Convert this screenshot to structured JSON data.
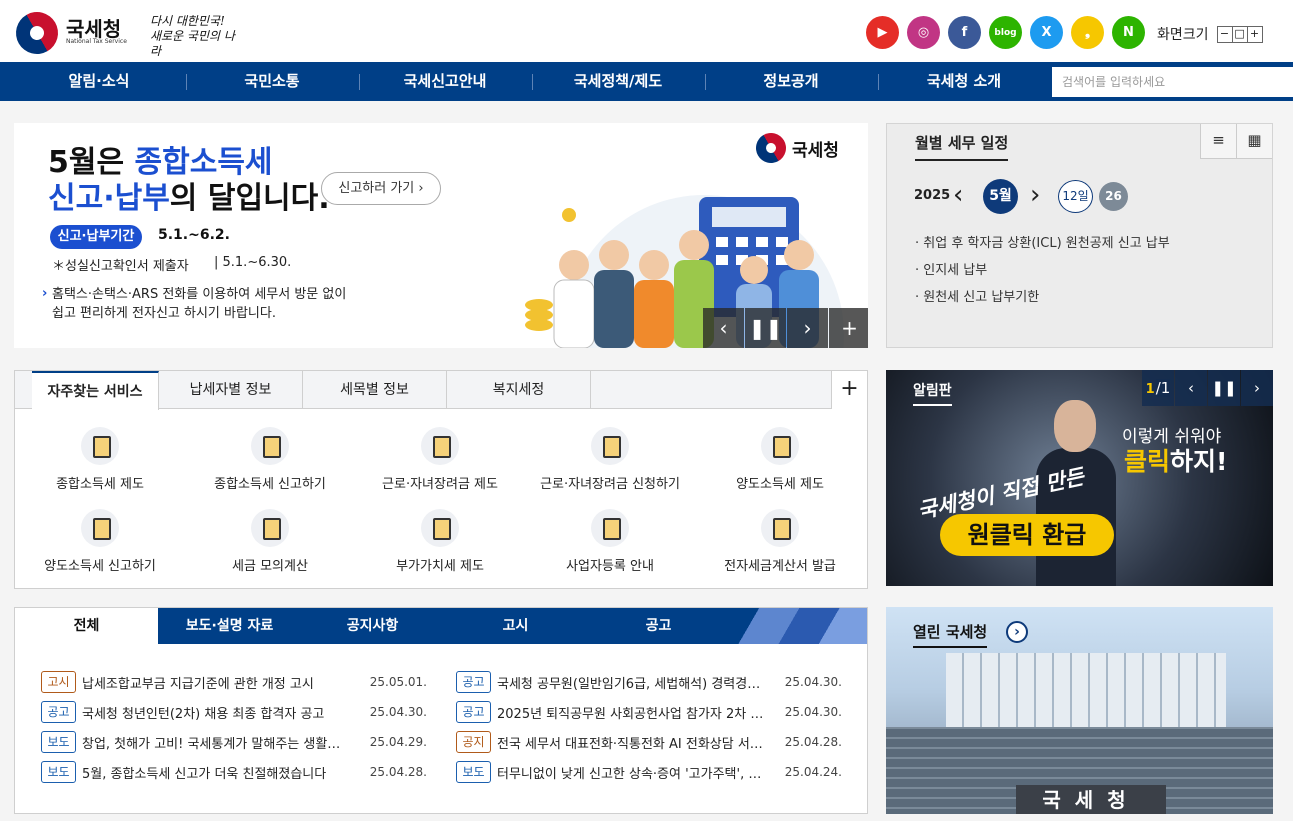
{
  "header": {
    "logo_title": "국세청",
    "logo_sub": "National Tax Service",
    "slogan": "다시 대한민국! 새로운 국민의 나라",
    "sns": [
      {
        "icon": "youtube-icon",
        "glyph": "▶",
        "color": "#e52d27"
      },
      {
        "icon": "instagram-icon",
        "glyph": "◎",
        "color": "#c13584"
      },
      {
        "icon": "facebook-icon",
        "glyph": "f",
        "color": "#3b5998"
      },
      {
        "icon": "blog-icon",
        "glyph": "blog",
        "color": "#2db400"
      },
      {
        "icon": "x-icon",
        "glyph": "X",
        "color": "#1d9bf0"
      },
      {
        "icon": "kakao-story-icon",
        "glyph": "❟",
        "color": "#f6c700"
      },
      {
        "icon": "naver-post-icon",
        "glyph": "N",
        "color": "#2db400"
      }
    ],
    "fontsize_label": "화면크기",
    "fontsize_buttons": [
      "−",
      "□",
      "+"
    ]
  },
  "gnb": {
    "items": [
      "알림·소식",
      "국민소통",
      "국세신고안내",
      "국세정책/제도",
      "정보공개",
      "국세청 소개"
    ],
    "search_placeholder": "검색어를 입력하세요"
  },
  "banner": {
    "line1_pre": "5월은 ",
    "line1_hl": "종합소득세",
    "line2_hl": "신고·납부",
    "line2_post": "의 달입니다.",
    "cta": "신고하러 가기 ›",
    "period_tag": "신고·납부기간",
    "period": "5.1.~6.2.",
    "sub_label": "＊성실신고확인서 제출자",
    "sub_period": "|   5.1.~6.30.",
    "desc1": "홈택스·손택스·ARS 전화를 이용하여 세무서 방문 없이",
    "desc2": "쉽고 편리하게 전자신고 하시기 바랍니다.",
    "brand": "국세청",
    "controls": [
      "‹",
      "❚❚",
      "›",
      "+"
    ]
  },
  "calendar": {
    "title": "월별 세무 일정",
    "icons": [
      "≡",
      "▦"
    ],
    "year": "2025",
    "prev": "‹",
    "month": "5월",
    "next": "›",
    "day_a": "12일",
    "day_b": "26",
    "items": [
      "취업 후 학자금 상환(ICL) 원천공제 신고 납부",
      "인지세 납부",
      "원천세 신고 납부기한"
    ]
  },
  "services": {
    "tabs": [
      "자주찾는 서비스",
      "납세자별 정보",
      "세목별 정보",
      "복지세정"
    ],
    "plus": "+",
    "items": [
      "종합소득세 제도",
      "종합소득세 신고하기",
      "근로·자녀장려금 제도",
      "근로·자녀장려금 신청하기",
      "양도소득세 제도",
      "양도소득세 신고하기",
      "세금 모의계산",
      "부가가치세 제도",
      "사업자등록 안내",
      "전자세금계산서 발급"
    ]
  },
  "notice": {
    "title": "알림판",
    "count_current": "1",
    "count_total": "/1",
    "controls": [
      "‹",
      "❚❚",
      "›"
    ],
    "q1": "이렇게 쉬워야",
    "q2_hl": "클릭",
    "q2_post": "하지!",
    "hand": "국세청이 직접 만든",
    "pill": "원클릭 환급"
  },
  "board": {
    "tabs": [
      "전체",
      "보도·설명 자료",
      "공지사항",
      "고시",
      "공고"
    ],
    "left": [
      {
        "tag": "고시",
        "type": "gosi",
        "title": "납세조합교부금 지급기준에 관한 개정 고시",
        "date": "25.05.01."
      },
      {
        "tag": "공고",
        "type": "gonggo",
        "title": "국세청 청년인턴(2차) 채용 최종 합격자 공고",
        "date": "25.04.30."
      },
      {
        "tag": "보도",
        "type": "bodo",
        "title": "창업, 첫해가 고비! 국세통계가 말해주는 생활…",
        "date": "25.04.29."
      },
      {
        "tag": "보도",
        "type": "bodo",
        "title": "5월, 종합소득세 신고가 더욱 친절해졌습니다",
        "date": "25.04.28."
      }
    ],
    "right": [
      {
        "tag": "공고",
        "type": "gonggo",
        "title": "국세청 공무원(일반임기6급, 세법해석) 경력경…",
        "date": "25.04.30."
      },
      {
        "tag": "공고",
        "type": "gonggo",
        "title": "2025년 퇴직공무원 사회공헌사업 참가자 2차 …",
        "date": "25.04.30."
      },
      {
        "tag": "공지",
        "type": "gongji",
        "title": "전국 세무서 대표전화·직통전화 AI 전화상담 서…",
        "date": "25.04.28."
      },
      {
        "tag": "보도",
        "type": "bodo",
        "title": "터무니없이 낮게 신고한 상속·증여 '고가주택', …",
        "date": "25.04.24."
      }
    ]
  },
  "open": {
    "title": "열린 국세청",
    "arrow": "›",
    "sign": "국세청"
  }
}
